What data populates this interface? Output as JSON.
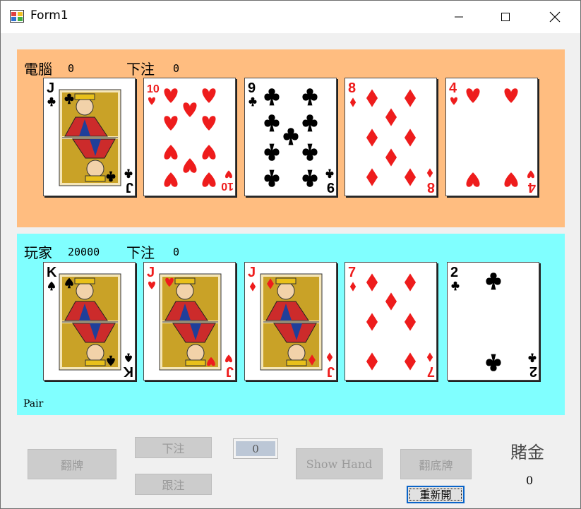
{
  "window": {
    "title": "Form1"
  },
  "computer": {
    "name_label": "電腦",
    "money": "0",
    "bet_label": "下注",
    "bet": "0",
    "panel_color": "#ffbd80",
    "cards": [
      {
        "rank": "J",
        "suit": "clubs",
        "color": "black",
        "face": true
      },
      {
        "rank": "10",
        "suit": "hearts",
        "color": "red",
        "face": false
      },
      {
        "rank": "9",
        "suit": "clubs",
        "color": "black",
        "face": false
      },
      {
        "rank": "8",
        "suit": "diamonds",
        "color": "red",
        "face": false
      },
      {
        "rank": "4",
        "suit": "hearts",
        "color": "red",
        "face": false
      }
    ]
  },
  "player": {
    "name_label": "玩家",
    "money": "20000",
    "bet_label": "下注",
    "bet": "0",
    "panel_color": "#80ffff",
    "hand_result": "Pair",
    "cards": [
      {
        "rank": "K",
        "suit": "spades",
        "color": "black",
        "face": true
      },
      {
        "rank": "J",
        "suit": "hearts",
        "color": "red",
        "face": true
      },
      {
        "rank": "J",
        "suit": "diamonds",
        "color": "red",
        "face": true
      },
      {
        "rank": "7",
        "suit": "diamonds",
        "color": "red",
        "face": false
      },
      {
        "rank": "2",
        "suit": "clubs",
        "color": "black",
        "face": false
      }
    ]
  },
  "controls": {
    "flip_label": "翻牌",
    "bet_label": "下注",
    "call_label": "跟注",
    "amount_value": "0",
    "show_hand_label": "Show Hand",
    "reveal_label": "翻底牌",
    "reset_label": "重新開",
    "pot_title": "賭金",
    "pot_value": "0"
  }
}
